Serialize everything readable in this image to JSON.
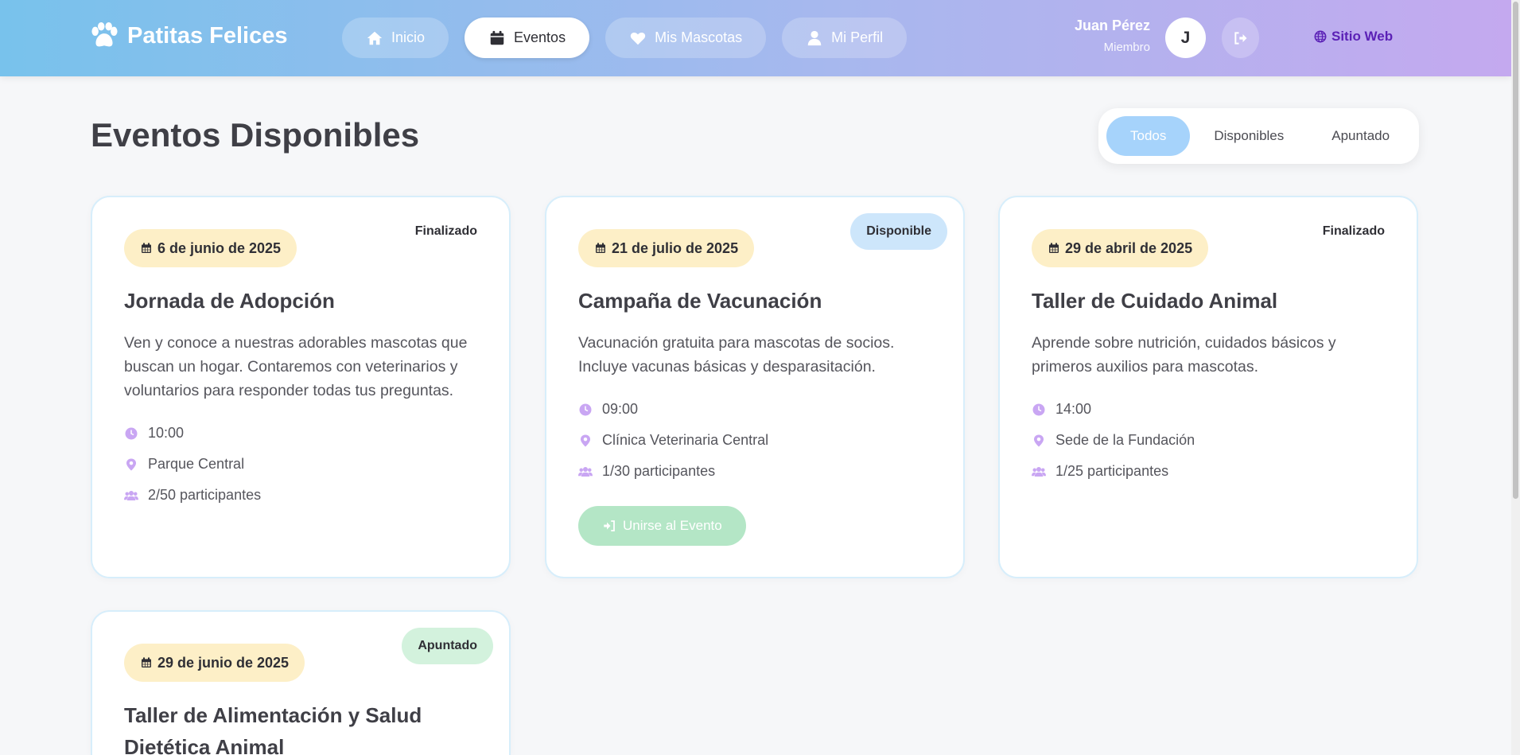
{
  "header": {
    "brand": "Patitas Felices",
    "nav": [
      {
        "label": "Inicio",
        "icon": "home-icon"
      },
      {
        "label": "Eventos",
        "icon": "calendar-icon",
        "active": true
      },
      {
        "label": "Mis Mascotas",
        "icon": "heart-icon"
      },
      {
        "label": "Mi Perfil",
        "icon": "user-icon"
      }
    ],
    "user": {
      "name": "Juan Pérez",
      "role": "Miembro",
      "initial": "J"
    },
    "site_link": "Sitio Web"
  },
  "page": {
    "title": "Eventos Disponibles"
  },
  "filters": [
    {
      "label": "Todos",
      "active": true
    },
    {
      "label": "Disponibles"
    },
    {
      "label": "Apuntado"
    }
  ],
  "events": [
    {
      "date": "6 de junio de 2025",
      "status": "Finalizado",
      "title": "Jornada de Adopción",
      "description": "Ven y conoce a nuestras adorables mascotas que buscan un hogar. Contaremos con veterinarios y voluntarios para responder todas tus preguntas.",
      "time": "10:00",
      "location": "Parque Central",
      "participants": "2/50 participantes"
    },
    {
      "date": "21 de julio de 2025",
      "status": "Disponible",
      "title": "Campaña de Vacunación",
      "description": "Vacunación gratuita para mascotas de socios. Incluye vacunas básicas y desparasitación.",
      "time": "09:00",
      "location": "Clínica Veterinaria Central",
      "participants": "1/30 participantes",
      "action": "Unirse al Evento"
    },
    {
      "date": "29 de abril de 2025",
      "status": "Finalizado",
      "title": "Taller de Cuidado Animal",
      "description": "Aprende sobre nutrición, cuidados básicos y primeros auxilios para mascotas.",
      "time": "14:00",
      "location": "Sede de la Fundación",
      "participants": "1/25 participantes"
    },
    {
      "date": "29 de junio de 2025",
      "status": "Apuntado",
      "title": "Taller de Alimentación y Salud Dietética Animal"
    }
  ],
  "colors": {
    "accent": "#c4a9ef",
    "icon": "#c9a6f3",
    "primary": "#a6d3fb",
    "available": "#cde6fb",
    "joined": "#d3f2dd",
    "date_bg": "#fdefc7"
  }
}
